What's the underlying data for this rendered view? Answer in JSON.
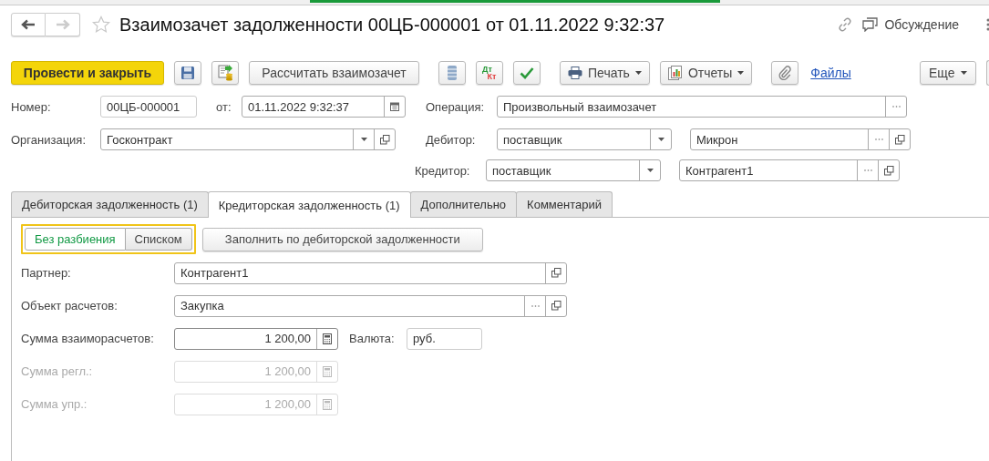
{
  "window": {
    "title": "Взаимозачет задолженности 00ЦБ-000001 от 01.11.2022 9:32:37",
    "discussion": "Обсуждение"
  },
  "toolbar": {
    "post_close": "Провести и закрыть",
    "calculate": "Рассчитать взаимозачет",
    "debit_credit": {
      "dt": "Дт",
      "kt": "Кт"
    },
    "print": "Печать",
    "reports": "Отчеты",
    "files": "Файлы",
    "more": "Еще"
  },
  "header": {
    "number": {
      "label": "Номер:",
      "value": "00ЦБ-000001"
    },
    "date": {
      "label": "от:",
      "value": "01.11.2022  9:32:37"
    },
    "operation": {
      "label": "Операция:",
      "value": "Произвольный взаимозачет"
    },
    "organization": {
      "label": "Организация:",
      "value": "Госконтракт"
    },
    "debtor": {
      "label": "Дебитор:",
      "type": "поставщик",
      "value": "Микрон"
    },
    "creditor": {
      "label": "Кредитор:",
      "type": "поставщик",
      "value": "Контрагент1"
    }
  },
  "tabs": [
    {
      "label": "Дебиторская задолженность (1)",
      "selected": false
    },
    {
      "label": "Кредиторская задолженность (1)",
      "selected": true
    },
    {
      "label": "Дополнительно",
      "selected": false
    },
    {
      "label": "Комментарий",
      "selected": false
    }
  ],
  "split_mode": [
    {
      "label": "Без разбиения",
      "selected": true
    },
    {
      "label": "Списком",
      "selected": false
    }
  ],
  "fill_button": "Заполнить по дебиторской задолженности",
  "partner": {
    "label": "Партнер:",
    "value": "Контрагент1"
  },
  "settlement_object": {
    "label": "Объект расчетов:",
    "value": "Закупка"
  },
  "amounts": [
    {
      "label": "Сумма взаиморасчетов:",
      "value": "1 200,00",
      "disabled": false
    },
    {
      "label": "Сумма регл.:",
      "value": "1 200,00",
      "disabled": true
    },
    {
      "label": "Сумма упр.:",
      "value": "1 200,00",
      "disabled": true
    }
  ],
  "currency": {
    "label": "Валюта:",
    "value": "руб."
  }
}
